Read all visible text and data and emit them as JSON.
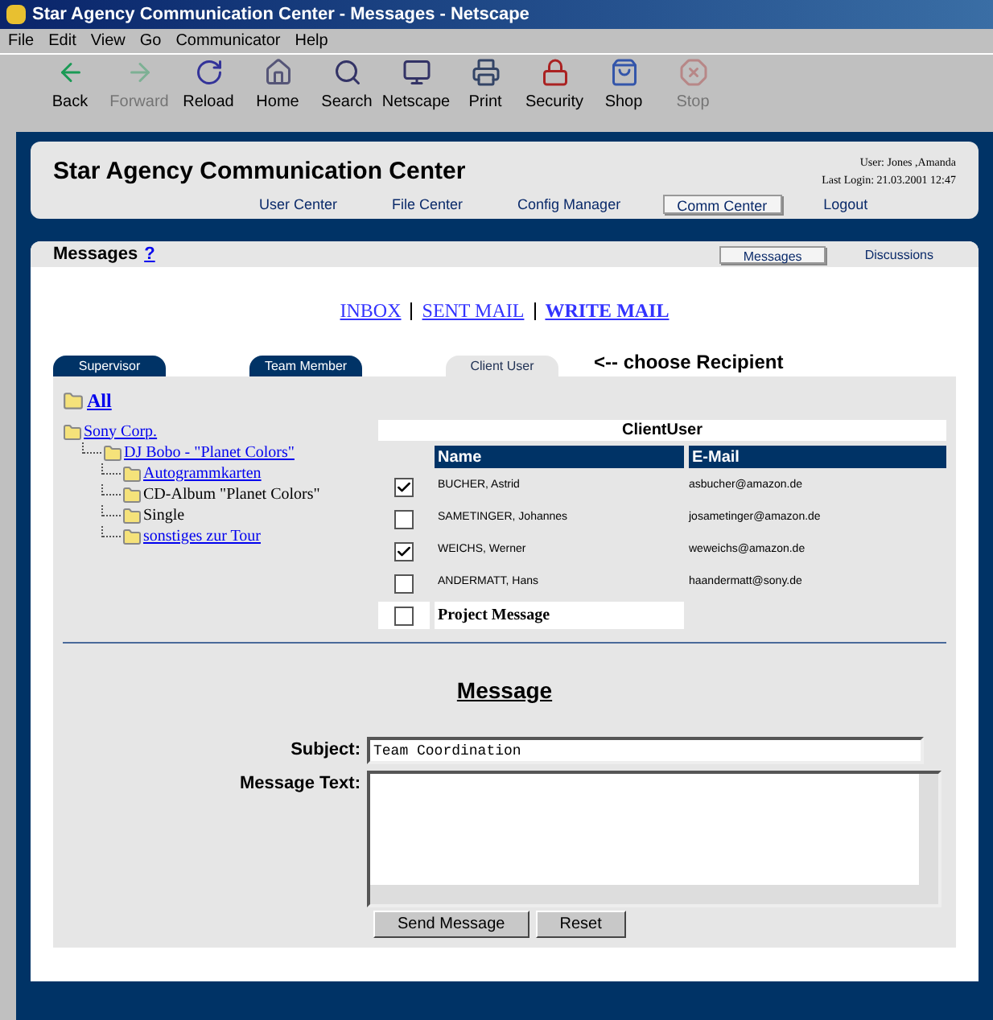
{
  "window": {
    "title": "Star Agency Communication Center - Messages - Netscape"
  },
  "menu": [
    "File",
    "Edit",
    "View",
    "Go",
    "Communicator",
    "Help"
  ],
  "toolbar": [
    {
      "label": "Back",
      "disabled": false
    },
    {
      "label": "Forward",
      "disabled": true
    },
    {
      "label": "Reload",
      "disabled": false
    },
    {
      "label": "Home",
      "disabled": false
    },
    {
      "label": "Search",
      "disabled": false
    },
    {
      "label": "Netscape",
      "disabled": false
    },
    {
      "label": "Print",
      "disabled": false
    },
    {
      "label": "Security",
      "disabled": false
    },
    {
      "label": "Shop",
      "disabled": false
    },
    {
      "label": "Stop",
      "disabled": true
    }
  ],
  "header": {
    "title": "Star Agency Communication Center",
    "user": "User: Jones ,Amanda",
    "last_login": "Last Login: 21.03.2001 12:47",
    "nav": [
      {
        "label": "User Center",
        "selected": false
      },
      {
        "label": "File Center",
        "selected": false
      },
      {
        "label": "Config Manager",
        "selected": false
      },
      {
        "label": "Comm Center",
        "selected": true
      },
      {
        "label": "Logout",
        "selected": false
      }
    ]
  },
  "messages": {
    "title": "Messages",
    "help": "?",
    "tabs": [
      {
        "label": "Messages",
        "selected": true
      },
      {
        "label": "Discussions",
        "selected": false
      }
    ],
    "mail_links": [
      {
        "label": "INBOX",
        "selected": false
      },
      {
        "label": "SENT MAIL",
        "selected": false
      },
      {
        "label": "WRITE MAIL",
        "selected": true
      }
    ],
    "recipient_tabs": [
      {
        "label": "Supervisor",
        "selected": false
      },
      {
        "label": "Team Member",
        "selected": false
      },
      {
        "label": "Client User",
        "selected": true
      }
    ],
    "recipient_hint": "<-- choose Recipient",
    "tree": {
      "label": "All",
      "children": [
        {
          "label": "Sony Corp.",
          "link": true,
          "children": [
            {
              "label": "DJ Bobo - \"Planet Colors\"",
              "link": true,
              "children": [
                {
                  "label": "Autogrammkarten",
                  "link": true
                },
                {
                  "label": "CD-Album \"Planet Colors\"",
                  "link": false
                },
                {
                  "label": "Single",
                  "link": false
                },
                {
                  "label": "sonstiges zur Tour",
                  "link": true
                }
              ]
            }
          ]
        }
      ]
    },
    "table": {
      "title": "ClientUser",
      "columns": [
        "Name",
        "E-Mail"
      ],
      "rows": [
        {
          "checked": true,
          "name": "BUCHER, Astrid",
          "email": "asbucher@amazon.de"
        },
        {
          "checked": false,
          "name": "SAMETINGER, Johannes",
          "email": "josametinger@amazon.de"
        },
        {
          "checked": true,
          "name": "WEICHS, Werner",
          "email": "weweichs@amazon.de"
        },
        {
          "checked": false,
          "name": "ANDERMATT, Hans",
          "email": "haandermatt@sony.de"
        }
      ],
      "project": {
        "checked": false,
        "label": "Project Message"
      }
    },
    "form": {
      "heading": "Message",
      "subject_label": "Subject:",
      "subject": "Team Coordination",
      "text_label": "Message Text:",
      "buttons": [
        "Send Message",
        "Reset"
      ]
    }
  }
}
